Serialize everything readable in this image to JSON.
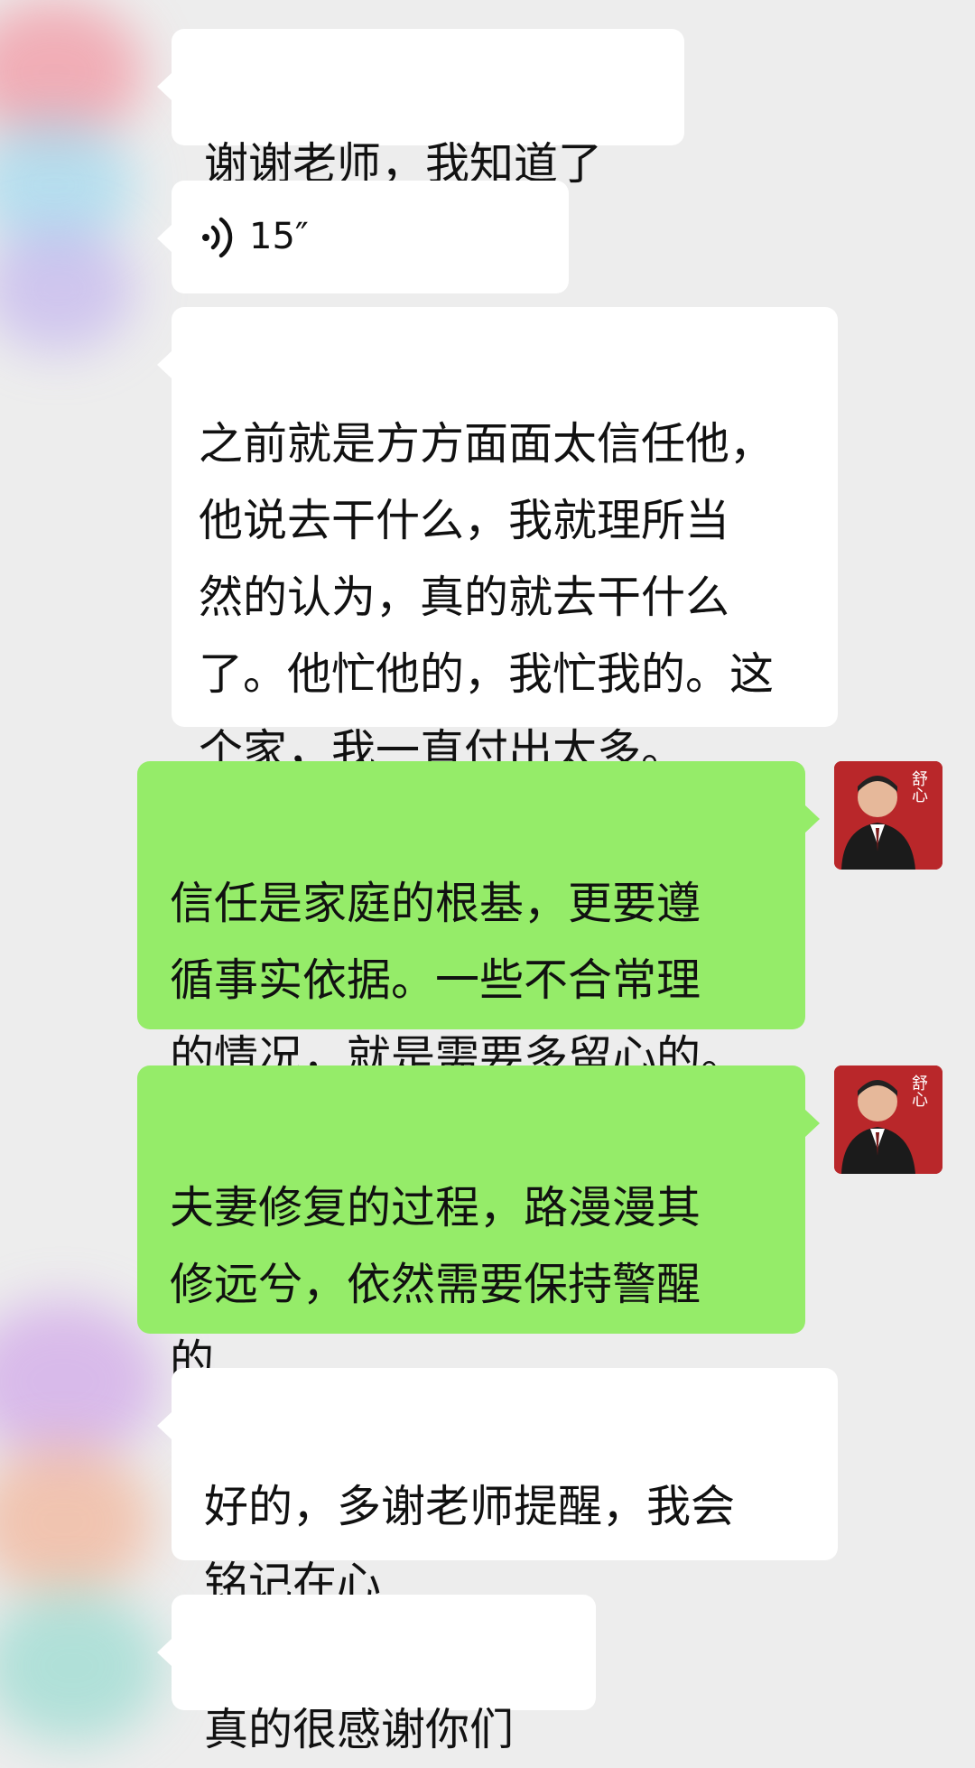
{
  "messages": [
    {
      "side": "in",
      "text": "谢谢老师，我知道了"
    },
    {
      "side": "in",
      "type": "voice",
      "duration": "15″"
    },
    {
      "side": "in",
      "text": "之前就是方方面面太信任他，\n他说去干什么，我就理所当\n然的认为，真的就去干什么\n了。他忙他的，我忙我的。这\n个家，我一直付出太多。"
    },
    {
      "side": "out",
      "text": "信任是家庭的根基，更要遵\n循事实依据。一些不合常理\n的情况，就是需要多留心的。"
    },
    {
      "side": "out",
      "text": "夫妻修复的过程，路漫漫其\n修远兮，依然需要保持警醒\n的"
    },
    {
      "side": "in",
      "text": "好的，多谢老师提醒，我会\n铭记在心"
    },
    {
      "side": "in",
      "text": "真的很感谢你们"
    }
  ],
  "avatar": {
    "label": "舒心",
    "bg_color": "#b9272a"
  },
  "colors": {
    "background": "#ededed",
    "incoming_bubble": "#ffffff",
    "outgoing_bubble": "#95ec69"
  },
  "icons": {
    "voice": "voice-wave-icon"
  }
}
